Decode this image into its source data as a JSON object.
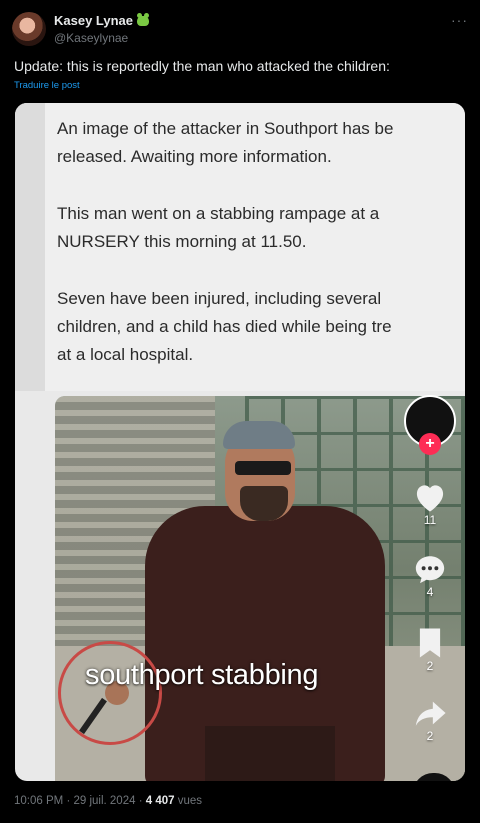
{
  "author": {
    "name": "Kasey Lynae",
    "handle": "@Kaseylynae",
    "badge_icon": "frog-emoji-icon"
  },
  "menu_icon": "more-horizontal-icon",
  "post": {
    "text": "Update: this is reportedly the man who attacked the children:",
    "translate_label": "Traduire le post"
  },
  "media": {
    "caption_lines": [
      "An image of the attacker in Southport has be",
      "released. Awaiting more information.",
      "This man went on a stabbing rampage at a",
      "NURSERY this morning at 11.50.",
      "Seven have been injured, including several",
      "children, and a child has died while being tre",
      "at a local hospital."
    ],
    "overlay_text": "southport stabbing",
    "likes": "11",
    "comments": "4",
    "saves": "2",
    "shares": "2",
    "accent_color": "#fe2c55"
  },
  "footer": {
    "time": "10:06 PM",
    "date": "29 juil. 2024",
    "views_count": "4 407",
    "views_label": "vues"
  }
}
